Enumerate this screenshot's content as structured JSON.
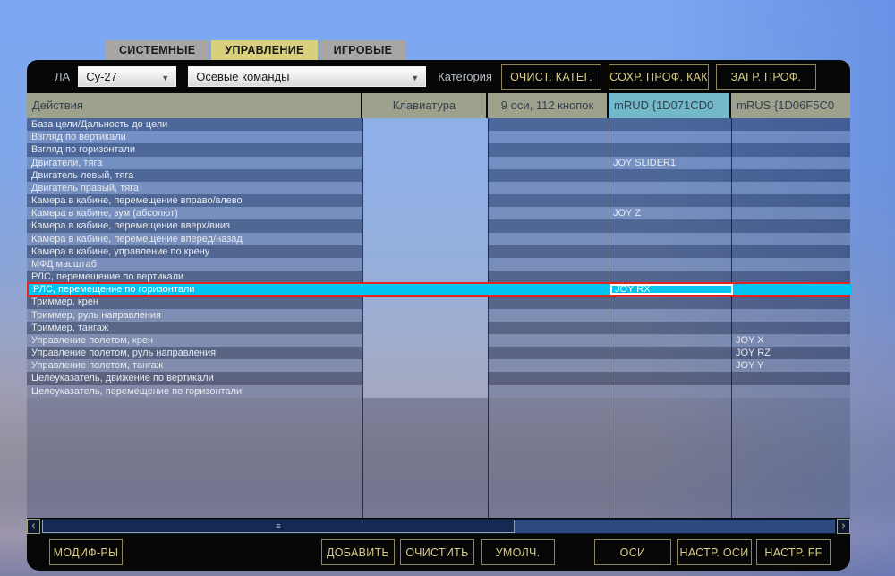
{
  "tabs": [
    {
      "label": "СИСТЕМНЫЕ",
      "active": false
    },
    {
      "label": "УПРАВЛЕНИЕ",
      "active": true
    },
    {
      "label": "ИГРОВЫЕ",
      "active": false
    }
  ],
  "topbar": {
    "aircraft_label": "ЛА",
    "aircraft_value": "Су-27",
    "command_filter_value": "Осевые команды",
    "category_label": "Категория",
    "buttons": [
      "ОЧИСТ. КАТЕГ.",
      "СОХР. ПРОФ. КАК",
      "ЗАГР. ПРОФ."
    ]
  },
  "table": {
    "columns": [
      {
        "label": "Действия",
        "align": "left",
        "highlight": false
      },
      {
        "label": "Клавиатура",
        "align": "center",
        "highlight": false
      },
      {
        "label": "9 оси, 112 кнопок",
        "align": "center",
        "highlight": false
      },
      {
        "label": "mRUD {1D071CD0",
        "align": "left",
        "highlight": true
      },
      {
        "label": "mRUS {1D06F5C0",
        "align": "left",
        "highlight": false
      }
    ],
    "rows": [
      {
        "action": "База цели/Дальность до цели",
        "kb": "",
        "axes": "",
        "mrud": "",
        "mrus": "",
        "selected": false
      },
      {
        "action": "Взгляд по вертикали",
        "kb": "",
        "axes": "",
        "mrud": "",
        "mrus": "",
        "selected": false
      },
      {
        "action": "Взгляд по горизонтали",
        "kb": "",
        "axes": "",
        "mrud": "",
        "mrus": "",
        "selected": false
      },
      {
        "action": "Двигатели, тяга",
        "kb": "",
        "axes": "",
        "mrud": "JOY SLIDER1",
        "mrus": "",
        "selected": false
      },
      {
        "action": "Двигатель левый, тяга",
        "kb": "",
        "axes": "",
        "mrud": "",
        "mrus": "",
        "selected": false
      },
      {
        "action": "Двигатель правый, тяга",
        "kb": "",
        "axes": "",
        "mrud": "",
        "mrus": "",
        "selected": false
      },
      {
        "action": "Камера в кабине,  перемещение вправо/влево",
        "kb": "",
        "axes": "",
        "mrud": "",
        "mrus": "",
        "selected": false
      },
      {
        "action": "Камера в кабине, зум (абсолют)",
        "kb": "",
        "axes": "",
        "mrud": "JOY Z",
        "mrus": "",
        "selected": false
      },
      {
        "action": "Камера в кабине, перемещение вверх/вниз",
        "kb": "",
        "axes": "",
        "mrud": "",
        "mrus": "",
        "selected": false
      },
      {
        "action": "Камера в кабине, перемещение вперед/назад",
        "kb": "",
        "axes": "",
        "mrud": "",
        "mrus": "",
        "selected": false
      },
      {
        "action": "Камера в кабине, управление по крену",
        "kb": "",
        "axes": "",
        "mrud": "",
        "mrus": "",
        "selected": false
      },
      {
        "action": "МФД масштаб",
        "kb": "",
        "axes": "",
        "mrud": "",
        "mrus": "",
        "selected": false
      },
      {
        "action": "РЛС, перемещение по вертикали",
        "kb": "",
        "axes": "",
        "mrud": "",
        "mrus": "",
        "selected": false
      },
      {
        "action": "РЛС, перемещение по горизонтали",
        "kb": "",
        "axes": "",
        "mrud": "JOY RX",
        "mrus": "",
        "selected": true
      },
      {
        "action": "Триммер, крен",
        "kb": "",
        "axes": "",
        "mrud": "",
        "mrus": "",
        "selected": false
      },
      {
        "action": "Триммер, руль направления",
        "kb": "",
        "axes": "",
        "mrud": "",
        "mrus": "",
        "selected": false
      },
      {
        "action": "Триммер, тангаж",
        "kb": "",
        "axes": "",
        "mrud": "",
        "mrus": "",
        "selected": false
      },
      {
        "action": "Управление полетом, крен",
        "kb": "",
        "axes": "",
        "mrud": "",
        "mrus": "JOY X",
        "selected": false
      },
      {
        "action": "Управление полетом, руль направления",
        "kb": "",
        "axes": "",
        "mrud": "",
        "mrus": "JOY RZ",
        "selected": false
      },
      {
        "action": "Управление полетом, тангаж",
        "kb": "",
        "axes": "",
        "mrud": "",
        "mrus": "JOY Y",
        "selected": false
      },
      {
        "action": "Целеуказатель, движение по вертикали",
        "kb": "",
        "axes": "",
        "mrud": "",
        "mrus": "",
        "selected": false
      },
      {
        "action": "Целеуказатель, перемещение по горизонтали",
        "kb": "",
        "axes": "",
        "mrud": "",
        "mrus": "",
        "selected": false
      }
    ],
    "selected_binding": "JOY RX"
  },
  "scrollbar": {
    "left_arrow": "‹",
    "right_arrow": "›",
    "grip": "≡"
  },
  "bottombar": {
    "buttons": [
      "МОДИФ-РЫ",
      "ДОБАВИТЬ",
      "ОЧИСТИТЬ",
      "УМОЛЧ.",
      "ОСИ",
      "НАСТР. ОСИ",
      "НАСТР. FF"
    ]
  },
  "colors": {
    "selection_cyan": "#00c4f2",
    "conflict_red": "#e3271e",
    "header_khaki": "#9ea18c",
    "header_highlight_teal": "#73b9ca",
    "tab_active_yellow": "#d9d07e",
    "button_gold_text": "#d8cc8a"
  }
}
